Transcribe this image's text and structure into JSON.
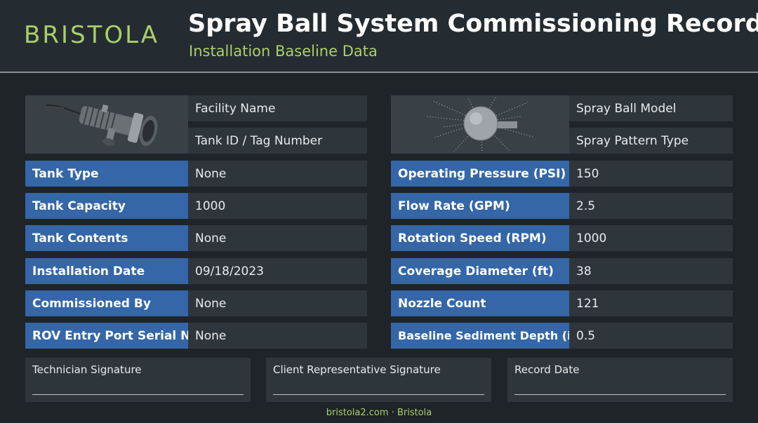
{
  "header": {
    "logo": "BRISTOLA",
    "title": "Spray Ball System Commissioning Record",
    "subtitle": "Installation Baseline Data"
  },
  "left": {
    "image_icon": "rov-entry-port-assembly-icon",
    "top_fields": [
      "Facility Name",
      "Tank ID / Tag Number"
    ],
    "rows": [
      {
        "label": "Tank Type",
        "value": "None"
      },
      {
        "label": "Tank Capacity",
        "value": "1000"
      },
      {
        "label": "Tank Contents",
        "value": "None"
      },
      {
        "label": "Installation Date",
        "value": "09/18/2023"
      },
      {
        "label": "Commissioned By",
        "value": "None"
      },
      {
        "label": "ROV Entry Port Serial No.",
        "value": "None"
      }
    ]
  },
  "right": {
    "image_icon": "spray-ball-icon",
    "top_fields": [
      "Spray Ball Model",
      "Spray Pattern Type"
    ],
    "rows": [
      {
        "label": "Operating Pressure (PSI)",
        "value": "150"
      },
      {
        "label": "Flow Rate (GPM)",
        "value": "2.5"
      },
      {
        "label": "Rotation Speed (RPM)",
        "value": "1000"
      },
      {
        "label": "Coverage Diameter (ft)",
        "value": "38"
      },
      {
        "label": "Nozzle Count",
        "value": "121"
      },
      {
        "label": "Baseline Sediment Depth (in)",
        "value": "0.5"
      }
    ]
  },
  "signatures": [
    "Technician Signature",
    "Client Representative Signature",
    "Record Date"
  ],
  "footer": "bristola2.com · Bristola",
  "colors": {
    "accent_green": "#a9cf6a",
    "label_blue": "#3466a8",
    "value_bg": "#2f363b",
    "page_bg": "#1e2428"
  }
}
